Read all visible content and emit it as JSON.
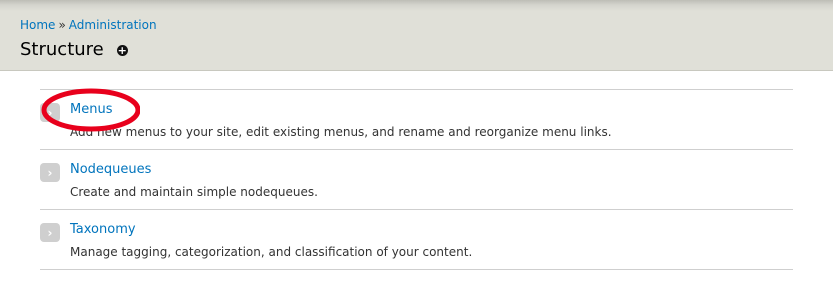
{
  "breadcrumb": {
    "items": [
      "Home",
      "Administration"
    ],
    "separator": "»"
  },
  "header": {
    "title": "Structure",
    "shortcut_icon": "add-shortcut-icon",
    "shortcut_glyph": "+"
  },
  "items": [
    {
      "title": "Menus",
      "description": "Add new menus to your site, edit existing menus, and rename and reorganize menu links."
    },
    {
      "title": "Nodequeues",
      "description": "Create and maintain simple nodequeues."
    },
    {
      "title": "Taxonomy",
      "description": "Manage tagging, categorization, and classification of your content."
    }
  ],
  "arrow_glyph": "›",
  "colors": {
    "link": "#0074bd",
    "header_bg": "#e0e0d8",
    "annotation": "#e8001c"
  }
}
